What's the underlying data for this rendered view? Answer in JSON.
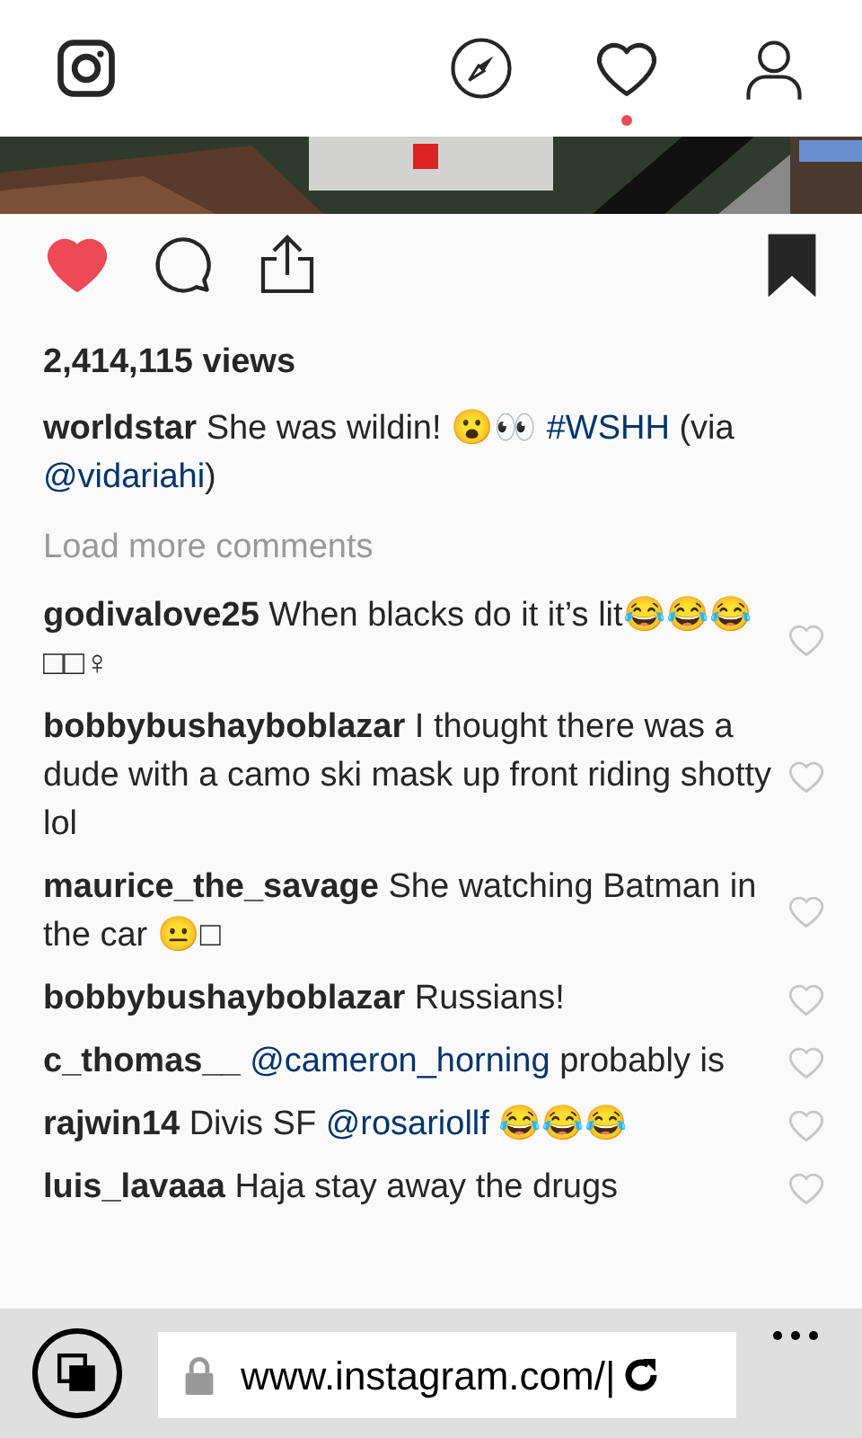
{
  "post": {
    "liked": true,
    "saved": true,
    "views": "2,414,115 views",
    "caption": {
      "user": "worldstar",
      "parts": [
        {
          "kind": "plain",
          "text": "She was wildin! 😮👀 "
        },
        {
          "kind": "link",
          "text": "#WSHH"
        },
        {
          "kind": "plain",
          "text": " (via "
        },
        {
          "kind": "link",
          "text": "@vidariahi"
        },
        {
          "kind": "plain",
          "text": ")"
        }
      ]
    }
  },
  "load_more": "Load more comments",
  "comments": [
    {
      "user": "godivalove25",
      "parts": [
        {
          "kind": "plain",
          "text": "When blacks do it it’s lit😂😂😂□□♀"
        }
      ]
    },
    {
      "user": "bobbybushayboblazar",
      "parts": [
        {
          "kind": "plain",
          "text": "I thought there was a dude with a camo ski mask up front riding shotty lol"
        }
      ]
    },
    {
      "user": "maurice_the_savage",
      "parts": [
        {
          "kind": "plain",
          "text": "She watching Batman in the car 😐□"
        }
      ]
    },
    {
      "user": "bobbybushayboblazar",
      "parts": [
        {
          "kind": "plain",
          "text": "Russians!"
        }
      ]
    },
    {
      "user": "c_thomas__",
      "parts": [
        {
          "kind": "link",
          "text": "@cameron_horning"
        },
        {
          "kind": "plain",
          "text": " probably is"
        }
      ]
    },
    {
      "user": "rajwin14",
      "parts": [
        {
          "kind": "plain",
          "text": "Divis SF "
        },
        {
          "kind": "link",
          "text": "@rosariollf"
        },
        {
          "kind": "plain",
          "text": " 😂😂😂"
        }
      ]
    },
    {
      "user": "luis_lavaaa",
      "parts": [
        {
          "kind": "plain",
          "text": "Haja stay away the drugs"
        }
      ]
    }
  ],
  "notifications": {
    "unread": true
  },
  "browser": {
    "url": "www.instagram.com/|"
  }
}
